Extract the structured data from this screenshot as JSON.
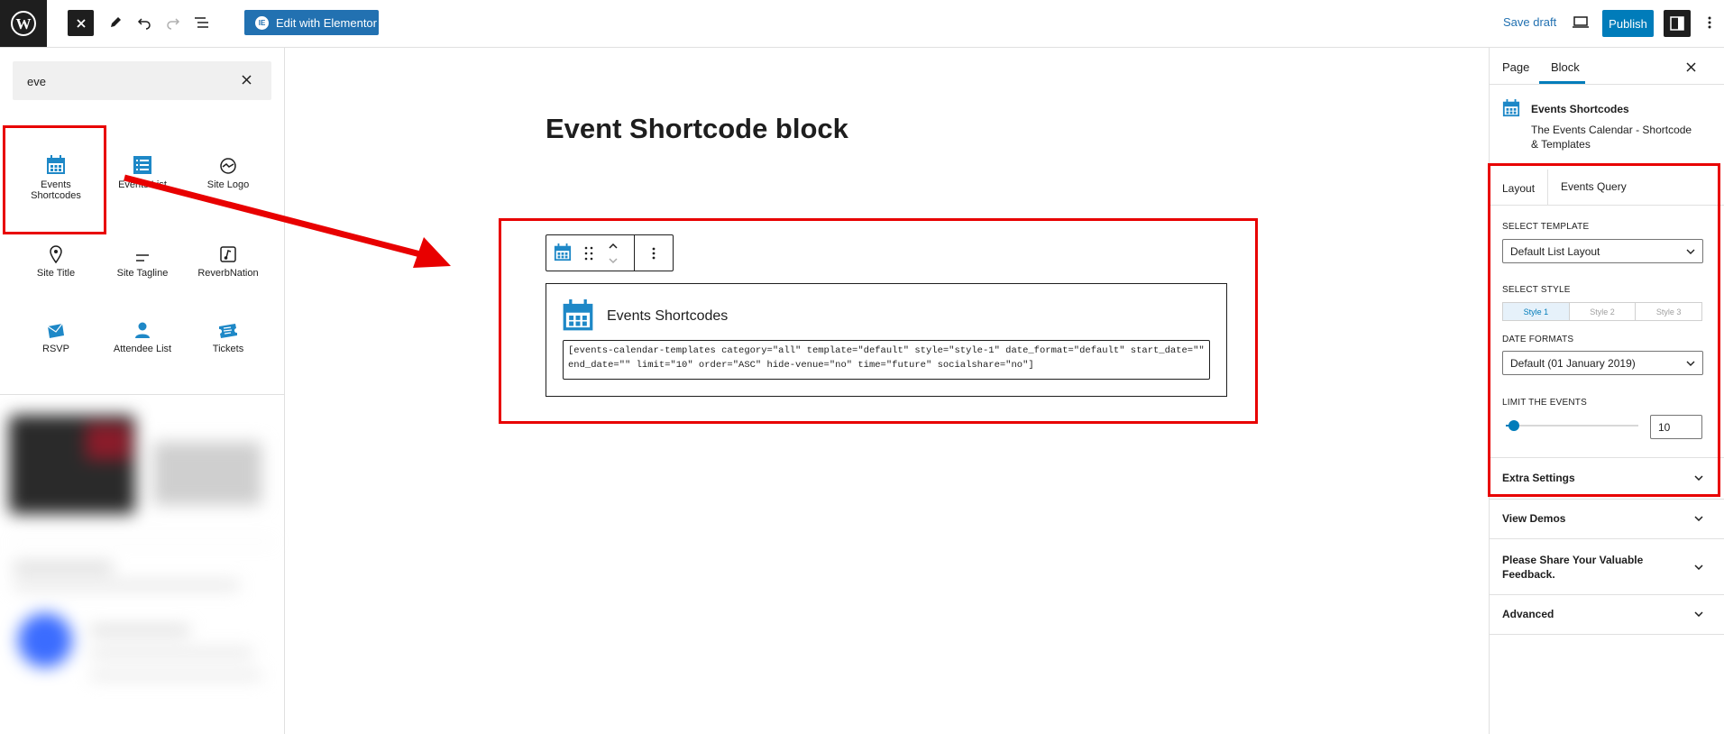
{
  "topbar": {
    "elementor_label": "Edit with Elementor",
    "save_draft_label": "Save draft",
    "publish_label": "Publish"
  },
  "inserter": {
    "search_value": "eve",
    "blocks": [
      {
        "label": "Events Shortcodes",
        "icon": "calendar-icon"
      },
      {
        "label": "Events List",
        "icon": "list-icon"
      },
      {
        "label": "Site Logo",
        "icon": "site-logo-icon"
      },
      {
        "label": "Site Title",
        "icon": "map-pin-icon"
      },
      {
        "label": "Site Tagline",
        "icon": "tagline-icon"
      },
      {
        "label": "ReverbNation",
        "icon": "reverbnation-icon"
      },
      {
        "label": "RSVP",
        "icon": "envelope-icon"
      },
      {
        "label": "Attendee List",
        "icon": "person-icon"
      },
      {
        "label": "Tickets",
        "icon": "ticket-icon"
      }
    ]
  },
  "canvas": {
    "page_title": "Event Shortcode block",
    "block_title": "Events Shortcodes",
    "shortcode": "[events-calendar-templates category=\"all\" template=\"default\" style=\"style-1\" date_format=\"default\" start_date=\"\" end_date=\"\" limit=\"10\" order=\"ASC\" hide-venue=\"no\" time=\"future\" socialshare=\"no\"]"
  },
  "sidebar": {
    "tabs": [
      "Page",
      "Block"
    ],
    "active_tab": "Block",
    "block_name": "Events Shortcodes",
    "block_description": "The Events Calendar - Shortcode & Templates",
    "inner_tabs": [
      "Layout",
      "Events Query"
    ],
    "select_template_label": "SELECT TEMPLATE",
    "select_template_value": "Default List Layout",
    "select_style_label": "SELECT STYLE",
    "styles": [
      "Style 1",
      "Style 2",
      "Style 3"
    ],
    "active_style": "Style 1",
    "date_formats_label": "DATE FORMATS",
    "date_format_value": "Default (01 January 2019)",
    "limit_label": "LIMIT THE EVENTS",
    "limit_value": "10",
    "panels": [
      "Extra Settings",
      "View Demos",
      "Please Share Your Valuable Feedback.",
      "Advanced"
    ]
  },
  "colors": {
    "accent": "#007cba",
    "annotation_red": "#e80000",
    "dark": "#1e1e1e"
  }
}
